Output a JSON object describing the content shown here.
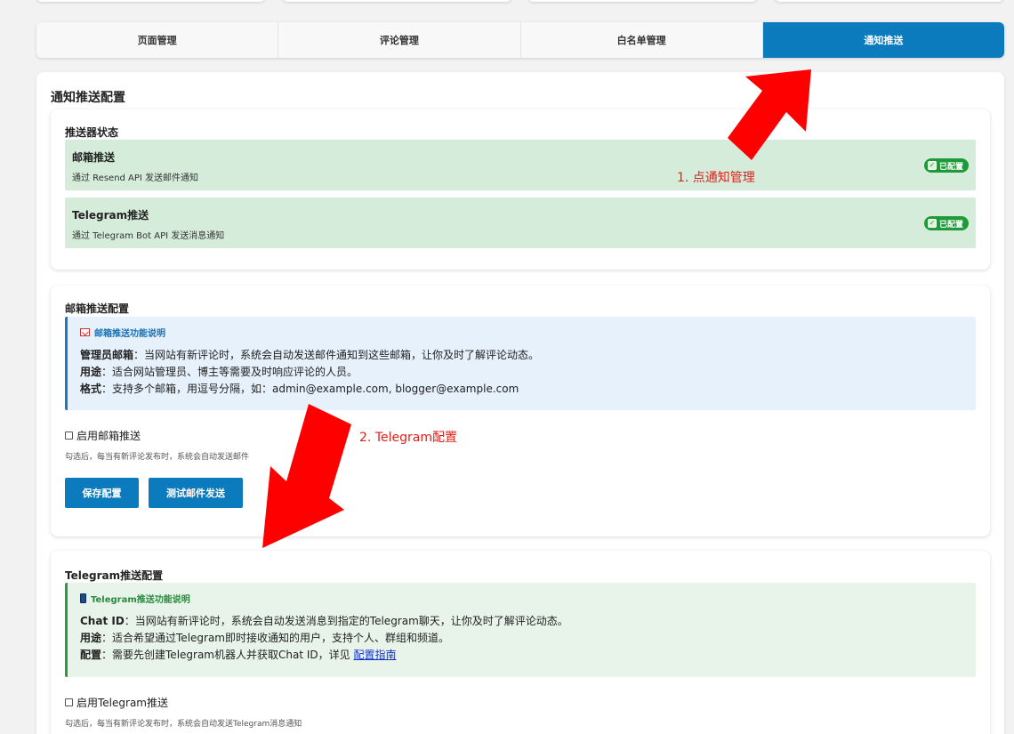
{
  "tabs": [
    {
      "label": "页面管理",
      "active": false
    },
    {
      "label": "评论管理",
      "active": false
    },
    {
      "label": "白名单管理",
      "active": false
    },
    {
      "label": "通知推送",
      "active": true
    }
  ],
  "page_title": "通知推送配置",
  "status_section": {
    "title": "推送器状态",
    "items": [
      {
        "name": "邮箱推送",
        "desc": "通过 Resend API 发送邮件通知",
        "badge": "已配置"
      },
      {
        "name": "Telegram推送",
        "desc": "通过 Telegram Bot API 发送消息通知",
        "badge": "已配置"
      }
    ]
  },
  "email_section": {
    "title": "邮箱推送配置",
    "info_title": "邮箱推送功能说明",
    "lines": [
      {
        "key": "管理员邮箱",
        "text": "：当网站有新评论时，系统会自动发送邮件通知到这些邮箱，让你及时了解评论动态。"
      },
      {
        "key": "用途",
        "text": "：适合网站管理员、博主等需要及时响应评论的人员。"
      },
      {
        "key": "格式",
        "text": "：支持多个邮箱，用逗号分隔，如：admin@example.com, blogger@example.com"
      }
    ],
    "enable_label": "启用邮箱推送",
    "hint": "勾选后，每当有新评论发布时，系统会自动发送邮件",
    "save_button": "保存配置",
    "test_button": "测试邮件发送"
  },
  "telegram_section": {
    "title": "Telegram推送配置",
    "info_title": "Telegram推送功能说明",
    "lines": [
      {
        "key": "Chat ID",
        "text": "：当网站有新评论时，系统会自动发送消息到指定的Telegram聊天，让你及时了解评论动态。"
      },
      {
        "key": "用途",
        "text": "：适合希望通过Telegram即时接收通知的用户，支持个人、群组和频道。"
      },
      {
        "key": "配置",
        "text": "：需要先创建Telegram机器人并获取Chat ID，详见 "
      }
    ],
    "guide_link": "配置指南",
    "enable_label": "启用Telegram推送",
    "hint": "勾选后，每当有新评论发布时，系统会自动发送Telegram消息通知"
  },
  "annotations": {
    "step1": "1. 点通知管理",
    "step2": "2. Telegram配置",
    "color": "#e0201c"
  },
  "colors": {
    "accent": "#0c7bbd",
    "status_bg": "#d5ecdb",
    "badge": "#1f9a3a"
  },
  "icons": {
    "badge": "check-box-icon",
    "email_info": "envelope-icon",
    "telegram_info": "phone-icon"
  }
}
